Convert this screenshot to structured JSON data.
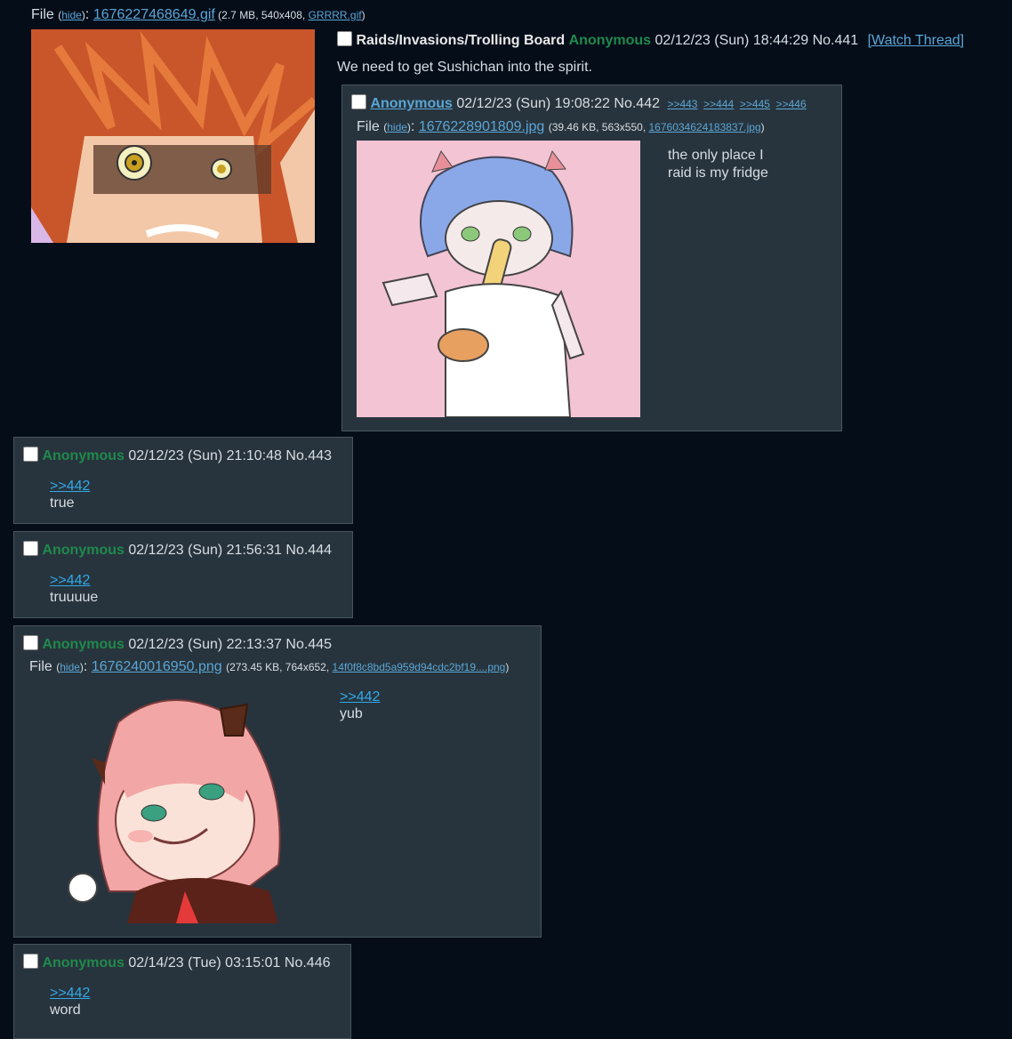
{
  "op": {
    "file_label": "File",
    "hide": "hide",
    "filename": "1676227468649.gif",
    "meta_pre": " (2.7 MB, 540x408, ",
    "orig_name": "GRRRR.gif",
    "meta_post": ")",
    "subject": "Raids/Invasions/Trolling Board",
    "name": "Anonymous",
    "datetime": "02/12/23 (Sun) 18:44:29",
    "no": "No.441",
    "watch": "[Watch Thread]",
    "comment": "We need to get Sushichan into the spirit."
  },
  "replies": [
    {
      "name": "Anonymous",
      "datetime": "02/12/23 (Sun) 19:08:22",
      "no": "No.442",
      "backlinks": [
        ">>443",
        ">>444",
        ">>445",
        ">>446"
      ],
      "file_label": "File",
      "hide": "hide",
      "filename": "1676228901809.jpg",
      "meta_pre": "(39.46 KB, 563x550, ",
      "orig_name": "1676034624183837.jpg",
      "meta_post": ")",
      "comment_lines": [
        "the only place I",
        "raid is my fridge"
      ]
    },
    {
      "name": "Anonymous",
      "datetime": "02/12/23 (Sun) 21:10:48",
      "no": "No.443",
      "quote": ">>442",
      "comment": "true"
    },
    {
      "name": "Anonymous",
      "datetime": "02/12/23 (Sun) 21:56:31",
      "no": "No.444",
      "quote": ">>442",
      "comment": "truuuue"
    },
    {
      "name": "Anonymous",
      "datetime": "02/12/23 (Sun) 22:13:37",
      "no": "No.445",
      "file_label": "File",
      "hide": "hide",
      "filename": "1676240016950.png",
      "meta_pre": "(273.45 KB, 764x652, ",
      "orig_name": "14f0f8c8bd5a959d94cdc2bf19....png",
      "meta_post": ")",
      "quote": ">>442",
      "comment": "yub"
    },
    {
      "name": "Anonymous",
      "datetime": "02/14/23 (Tue) 03:15:01",
      "no": "No.446",
      "quote": ">>442",
      "comment": "word"
    }
  ],
  "colors": {
    "background": "#050d19",
    "reply_bg": "#28343d",
    "name_green": "#1f8a4c",
    "link_blue": "#5aa6d6"
  }
}
